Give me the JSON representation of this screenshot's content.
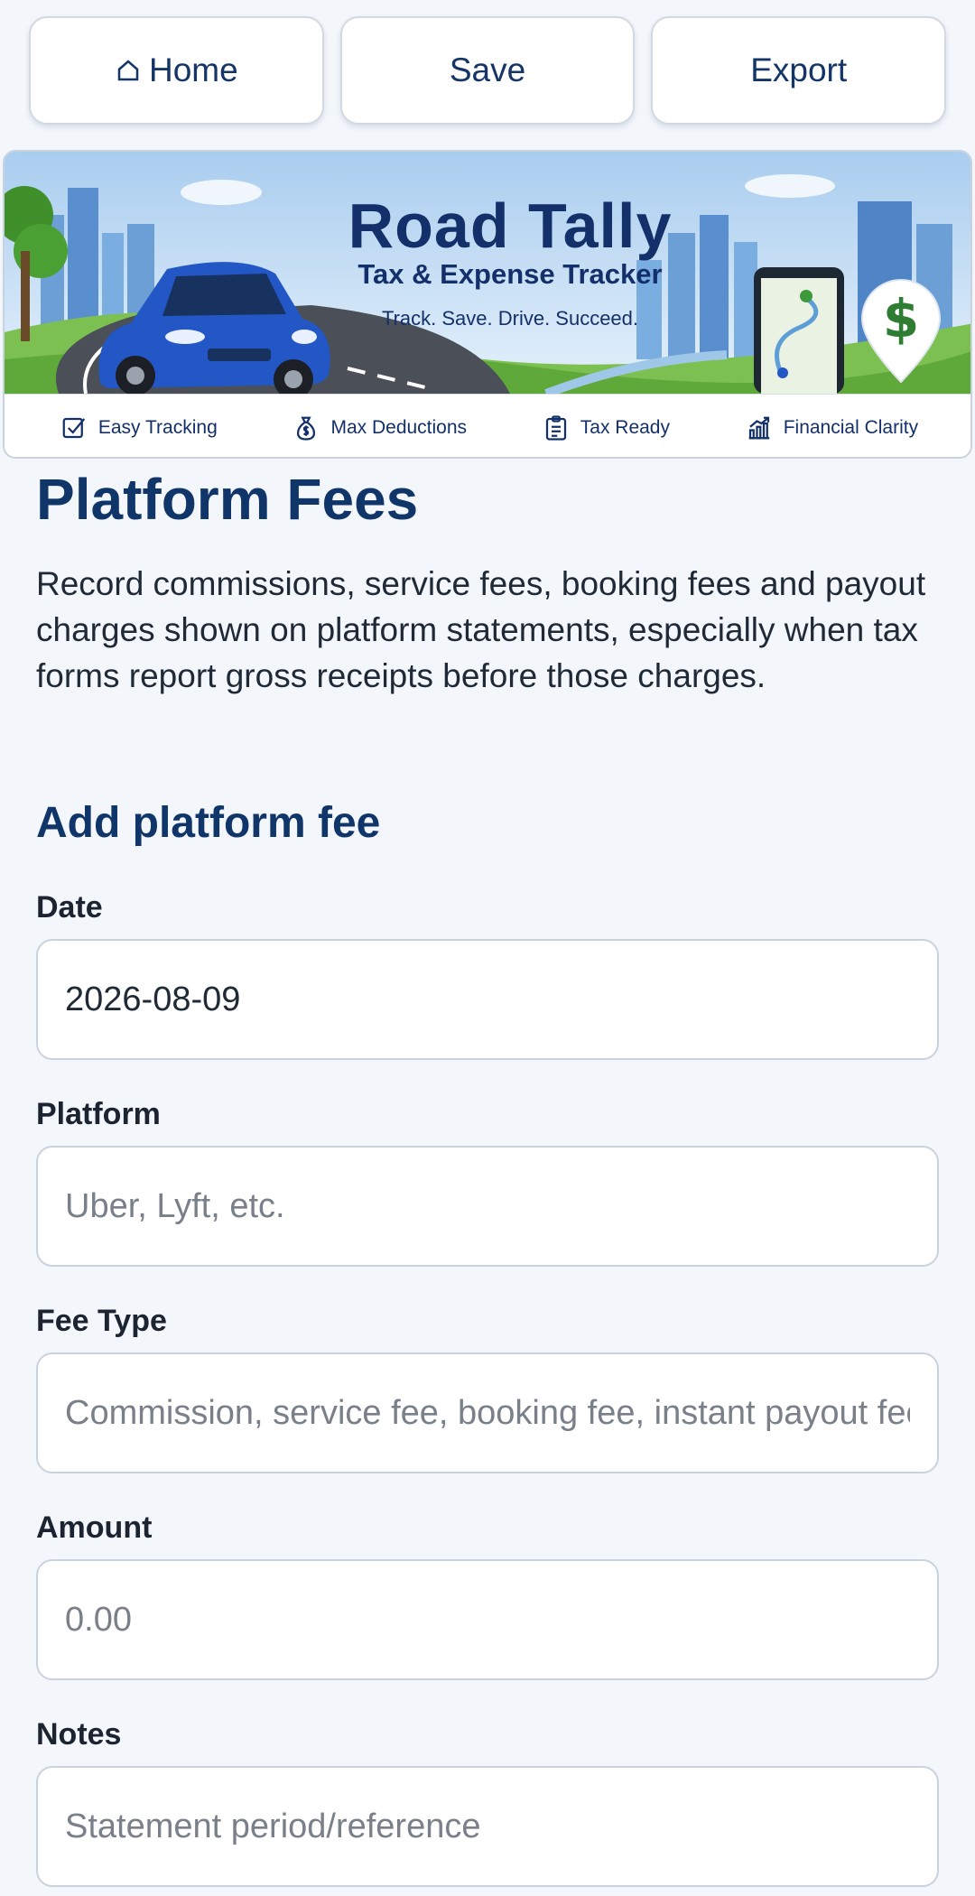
{
  "nav": {
    "home_label": "Home",
    "save_label": "Save",
    "export_label": "Export"
  },
  "banner": {
    "title": "Road Tally",
    "subtitle": "Tax & Expense Tracker",
    "tagline": "Track. Save. Drive. Succeed.",
    "features": [
      {
        "label": "Easy Tracking",
        "icon": "checkbox-icon"
      },
      {
        "label": "Max Deductions",
        "icon": "money-bag-icon"
      },
      {
        "label": "Tax Ready",
        "icon": "clipboard-icon"
      },
      {
        "label": "Financial Clarity",
        "icon": "growth-chart-icon"
      }
    ]
  },
  "page": {
    "title": "Platform Fees",
    "description": "Record commissions, service fees, booking fees and payout charges shown on platform statements, especially when tax forms report gross receipts before those charges."
  },
  "form": {
    "section_title": "Add platform fee",
    "date": {
      "label": "Date",
      "value": "2026-08-09"
    },
    "platform": {
      "label": "Platform",
      "placeholder": "Uber, Lyft, etc."
    },
    "fee_type": {
      "label": "Fee Type",
      "placeholder": "Commission, service fee, booking fee, instant payout fee"
    },
    "amount": {
      "label": "Amount",
      "placeholder": "0.00"
    },
    "notes": {
      "label": "Notes",
      "placeholder": "Statement period/reference"
    }
  },
  "colors": {
    "primary": "#0f3569",
    "background": "#f3f6fb",
    "input_border": "#c9d2df",
    "accent_green": "#2f7d32"
  }
}
